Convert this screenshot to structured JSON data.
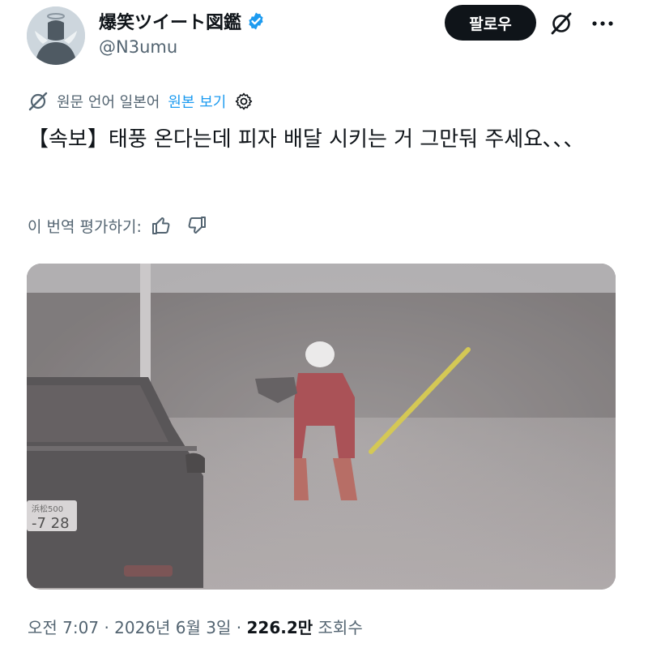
{
  "author": {
    "display_name": "爆笑ツイート図鑑",
    "handle": "@N3umu",
    "verified": true,
    "verified_color": "#1d9bf0"
  },
  "actions": {
    "follow_label": "팔로우"
  },
  "translation": {
    "source_language_label": "원문 언어 일본어",
    "view_original_label": "원본 보기"
  },
  "tweet": {
    "text": "【속보】태풍 온다는데 피자 배달 시키는 거 그만둬 주세요､､､"
  },
  "rating": {
    "label": "이 번역 평가하기:"
  },
  "media": {
    "license_plate_small": "浜松500",
    "license_plate_number": "-7 28"
  },
  "meta": {
    "time": "오전 7:07",
    "date": "2026년 6월 3일",
    "separator": "·",
    "views_count": "226.2만",
    "views_label": "조회수"
  },
  "icons": [
    "verified-badge-icon",
    "grok-icon",
    "more-icon",
    "translate-icon",
    "settings-icon",
    "thumbs-up-icon",
    "thumbs-down-icon"
  ],
  "colors": {
    "accent": "#1d9bf0",
    "text_primary": "#0f1419",
    "text_secondary": "#536471",
    "follow_button_bg": "#0f1419"
  }
}
